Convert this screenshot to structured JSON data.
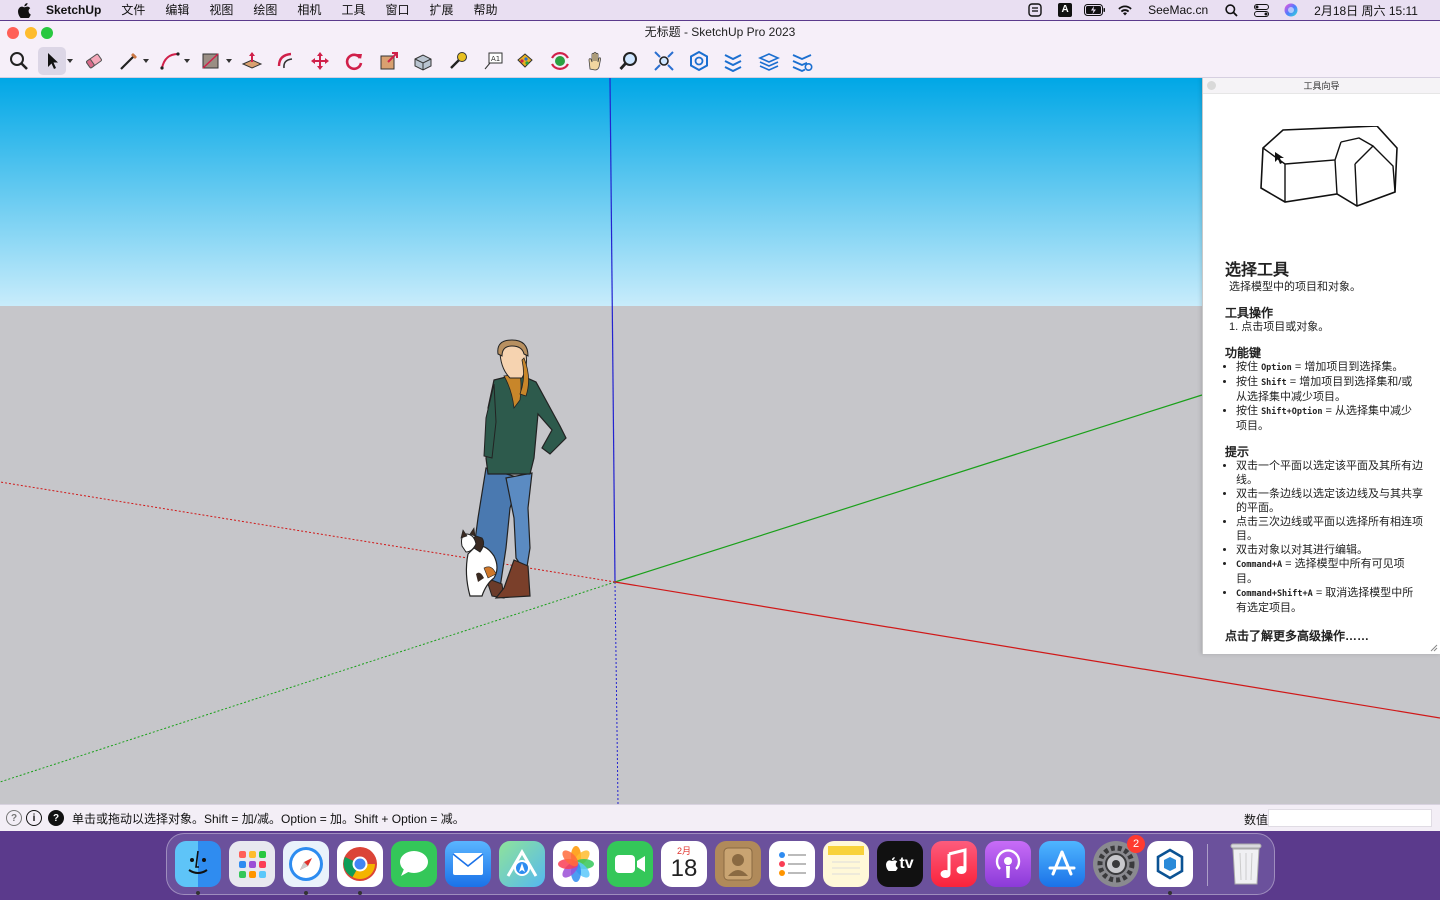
{
  "menubar": {
    "app_name": "SketchUp",
    "items": [
      "文件",
      "编辑",
      "视图",
      "绘图",
      "相机",
      "工具",
      "窗口",
      "扩展",
      "帮助"
    ],
    "input_badge": "A",
    "site": "SeeMac.cn",
    "clock": "2月18日 周六  15:11",
    "status_icons": [
      "scroll-icon",
      "input-source-icon",
      "battery-icon",
      "wifi-icon",
      "spotlight-icon",
      "control-center-icon",
      "siri-icon"
    ]
  },
  "window": {
    "title": "无标题 - SketchUp Pro 2023",
    "traffic_colors": {
      "close": "#ff5f57",
      "minimize": "#febc2e",
      "zoom": "#28c840"
    }
  },
  "toolbar": {
    "tools": [
      "search-tool-icon",
      "select-tool-icon",
      "eraser-tool-icon",
      "line-tool-icon",
      "arc-tool-icon",
      "rectangle-tool-icon",
      "push-pull-tool-icon",
      "offset-tool-icon",
      "move-tool-icon",
      "rotate-tool-icon",
      "scale-tool-icon",
      "follow-me-tool-icon",
      "tape-measure-tool-icon",
      "text-tool-icon",
      "paint-bucket-tool-icon",
      "orbit-tool-icon",
      "pan-tool-icon",
      "zoom-tool-icon",
      "zoom-extents-tool-icon",
      "warehouse-icon",
      "extension-warehouse-icon",
      "layout-icon",
      "sketchup-layers-icon"
    ],
    "active_tool": "select-tool-icon"
  },
  "scene": {
    "sky_top": "#00a7e6",
    "sky_bottom": "#c8ecfb",
    "ground": "#c6c6ca",
    "axis_colors": {
      "red": "#d01818",
      "green": "#1aa01a",
      "blue": "#2222d0"
    }
  },
  "instructor": {
    "panel_title": "工具向导",
    "heading": "选择工具",
    "description": "选择模型中的项目和对象。",
    "ops_heading": "工具操作",
    "ops": [
      "1. 点击项目或对象。"
    ],
    "keys_heading": "功能键",
    "keys": [
      {
        "pre": "按住 ",
        "key": "Option",
        "post": " = 增加项目到选择集。"
      },
      {
        "pre": "按住 ",
        "key": "Shift",
        "post": " = 增加项目到选择集和/或从选择集中减少项目。"
      },
      {
        "pre": "按住 ",
        "key": "Shift+Option",
        "post": " = 从选择集中减少项目。"
      }
    ],
    "tips_heading": "提示",
    "tips": [
      {
        "pre": "",
        "key": "",
        "post": "双击一个平面以选定该平面及其所有边线。"
      },
      {
        "pre": "",
        "key": "",
        "post": "双击一条边线以选定该边线及与其共享的平面。"
      },
      {
        "pre": "",
        "key": "",
        "post": "点击三次边线或平面以选择所有相连项目。"
      },
      {
        "pre": "",
        "key": "",
        "post": "双击对象以对其进行编辑。"
      },
      {
        "pre": "",
        "key": "Command+A",
        "post": " = 选择模型中所有可见项目。"
      },
      {
        "pre": "",
        "key": "Command+Shift+A",
        "post": " = 取消选择模型中所有选定项目。"
      }
    ],
    "more_link": "点击了解更多高级操作……"
  },
  "statusbar": {
    "message": "单击或拖动以选择对象。Shift = 加/减。Option = 加。Shift + Option = 减。",
    "vcb_label": "数值",
    "vcb_value": ""
  },
  "dock": {
    "apps": [
      {
        "name": "finder-icon",
        "color": "#2f8cf0",
        "running": true
      },
      {
        "name": "launchpad-icon",
        "color": "#e8e8ef",
        "running": false
      },
      {
        "name": "safari-icon",
        "color": "#e9f2fb",
        "running": true
      },
      {
        "name": "chrome-icon",
        "color": "#ffffff",
        "running": true
      },
      {
        "name": "messages-icon",
        "color": "#34c759",
        "running": false
      },
      {
        "name": "mail-icon",
        "color": "#2a8cf7",
        "running": false
      },
      {
        "name": "maps-icon",
        "color": "#6fd17a",
        "running": false
      },
      {
        "name": "photos-icon",
        "color": "#ffffff",
        "running": false
      },
      {
        "name": "facetime-icon",
        "color": "#34c759",
        "running": false
      },
      {
        "name": "calendar-icon",
        "color": "#ffffff",
        "running": false
      },
      {
        "name": "contacts-icon",
        "color": "#b08a5a",
        "running": false
      },
      {
        "name": "reminders-icon",
        "color": "#ffffff",
        "running": false
      },
      {
        "name": "notes-icon",
        "color": "#fff8d8",
        "running": false
      },
      {
        "name": "apple-tv-icon",
        "color": "#111111",
        "running": false
      },
      {
        "name": "music-icon",
        "color": "#fa3e55",
        "running": false
      },
      {
        "name": "podcasts-icon",
        "color": "#9b4fd6",
        "running": false
      },
      {
        "name": "app-store-icon",
        "color": "#1c8bf5",
        "running": false
      },
      {
        "name": "system-settings-icon",
        "color": "#8a8a8f",
        "running": false
      },
      {
        "name": "sketchup-icon",
        "color": "#ffffff",
        "running": true
      },
      {
        "name": "trash-icon",
        "color": "#e6e6ea",
        "running": false
      }
    ],
    "calendar_month": "2月",
    "calendar_day": "18",
    "tv_label": "tv",
    "settings_badge": "2"
  }
}
